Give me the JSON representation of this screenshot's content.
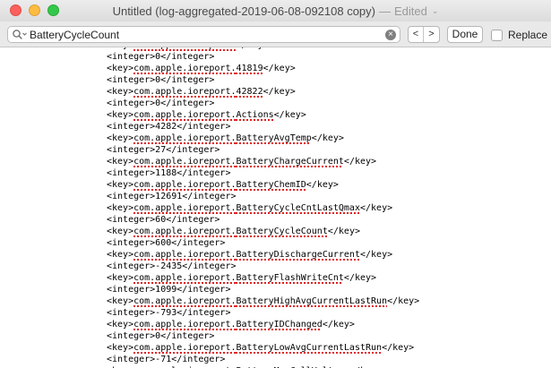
{
  "window": {
    "title": "Untitled (log-aggregated-2019-06-08-092108 copy)",
    "separator": "—",
    "status": "Edited"
  },
  "find": {
    "query": "BatteryCycleCount",
    "prev_glyph": "<",
    "next_glyph": ">",
    "done_label": "Done",
    "replace_label": "Replace"
  },
  "lines": [
    {
      "pre": "<key>",
      "mid": "com.apple.ioreport.",
      "tail": "",
      "post": "</key>"
    },
    {
      "pre": "<integer>0</integer>",
      "mid": "",
      "tail": "",
      "post": ""
    },
    {
      "pre": "<key>",
      "mid": "com.apple.ioreport.",
      "tail": "41819",
      "post": "</key>"
    },
    {
      "pre": "<integer>0</integer>",
      "mid": "",
      "tail": "",
      "post": ""
    },
    {
      "pre": "<key>",
      "mid": "com.apple.ioreport.",
      "tail": "42822",
      "post": "</key>"
    },
    {
      "pre": "<integer>0</integer>",
      "mid": "",
      "tail": "",
      "post": ""
    },
    {
      "pre": "<key>",
      "mid": "com.apple.ioreport.",
      "tail": "Actions",
      "post": "</key>"
    },
    {
      "pre": "<integer>4282</integer>",
      "mid": "",
      "tail": "",
      "post": ""
    },
    {
      "pre": "<key>",
      "mid": "com.apple.ioreport.",
      "tail": "BatteryAvgTemp",
      "post": "</key>"
    },
    {
      "pre": "<integer>27</integer>",
      "mid": "",
      "tail": "",
      "post": ""
    },
    {
      "pre": "<key>",
      "mid": "com.apple.ioreport.",
      "tail": "BatteryChargeCurrent",
      "post": "</key>"
    },
    {
      "pre": "<integer>1188</integer>",
      "mid": "",
      "tail": "",
      "post": ""
    },
    {
      "pre": "<key>",
      "mid": "com.apple.ioreport.",
      "tail": "BatteryChemID",
      "post": "</key>"
    },
    {
      "pre": "<integer>12691</integer>",
      "mid": "",
      "tail": "",
      "post": ""
    },
    {
      "pre": "<key>",
      "mid": "com.apple.ioreport.",
      "tail": "BatteryCycleCntLastQmax",
      "post": "</key>"
    },
    {
      "pre": "<integer>60</integer>",
      "mid": "",
      "tail": "",
      "post": ""
    },
    {
      "pre": "<key>",
      "mid": "com.apple.ioreport.",
      "tail": "BatteryCycleCount",
      "post": "</key>"
    },
    {
      "pre": "<integer>600</integer>",
      "mid": "",
      "tail": "",
      "post": ""
    },
    {
      "pre": "<key>",
      "mid": "com.apple.ioreport.",
      "tail": "BatteryDischargeCurrent",
      "post": "</key>"
    },
    {
      "pre": "<integer>-2435</integer>",
      "mid": "",
      "tail": "",
      "post": ""
    },
    {
      "pre": "<key>",
      "mid": "com.apple.ioreport.",
      "tail": "BatteryFlashWriteCnt",
      "post": "</key>"
    },
    {
      "pre": "<integer>1099</integer>",
      "mid": "",
      "tail": "",
      "post": ""
    },
    {
      "pre": "<key>",
      "mid": "com.apple.ioreport.",
      "tail": "BatteryHighAvgCurrentLastRun",
      "post": "</key>"
    },
    {
      "pre": "<integer>-793</integer>",
      "mid": "",
      "tail": "",
      "post": ""
    },
    {
      "pre": "<key>",
      "mid": "com.apple.ioreport.",
      "tail": "BatteryIDChanged",
      "post": "</key>"
    },
    {
      "pre": "<integer>0</integer>",
      "mid": "",
      "tail": "",
      "post": ""
    },
    {
      "pre": "<key>",
      "mid": "com.apple.ioreport.",
      "tail": "BatteryLowAvgCurrentLastRun",
      "post": "</key>"
    },
    {
      "pre": "<integer>-71</integer>",
      "mid": "",
      "tail": "",
      "post": ""
    },
    {
      "pre": "<key>",
      "mid": "com.apple.ioreport.",
      "tail": "BatteryMaxCellVoltage",
      "post": "</key>"
    }
  ]
}
